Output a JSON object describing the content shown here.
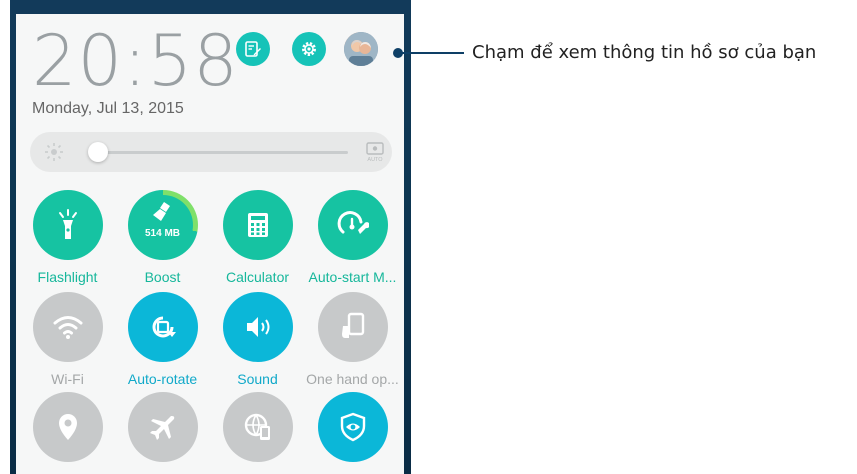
{
  "status": {
    "time": "20:58",
    "date": "Monday, Jul 13, 2015"
  },
  "header": {
    "icons": [
      "notes-edit-icon",
      "settings-gear-icon",
      "profile-avatar"
    ]
  },
  "brightness": {
    "auto_label": "AUTO",
    "level_fraction": 0.0
  },
  "tiles": [
    {
      "label": "Flashlight",
      "icon": "flashlight-icon",
      "state": "on"
    },
    {
      "label": "Boost",
      "icon": "broom-icon",
      "state": "on",
      "memory": "514 MB"
    },
    {
      "label": "Calculator",
      "icon": "calculator-icon",
      "state": "on"
    },
    {
      "label": "Auto-start M...",
      "icon": "gauge-wrench-icon",
      "state": "on"
    },
    {
      "label": "Wi-Fi",
      "icon": "wifi-icon",
      "state": "off"
    },
    {
      "label": "Auto-rotate",
      "icon": "auto-rotate-icon",
      "state": "on"
    },
    {
      "label": "Sound",
      "icon": "sound-icon",
      "state": "on"
    },
    {
      "label": "One hand op...",
      "icon": "one-hand-icon",
      "state": "off"
    },
    {
      "label": "",
      "icon": "location-pin-icon",
      "state": "off"
    },
    {
      "label": "",
      "icon": "airplane-icon",
      "state": "off"
    },
    {
      "label": "",
      "icon": "globe-phone-icon",
      "state": "off"
    },
    {
      "label": "",
      "icon": "eye-shield-icon",
      "state": "on"
    }
  ],
  "callout": {
    "text": "Chạm để xem thông tin hồ sơ của bạn"
  },
  "colors": {
    "accent_green": "#16c3a2",
    "accent_cyan": "#0bb7d8",
    "off_grey": "#c7c9ca"
  }
}
